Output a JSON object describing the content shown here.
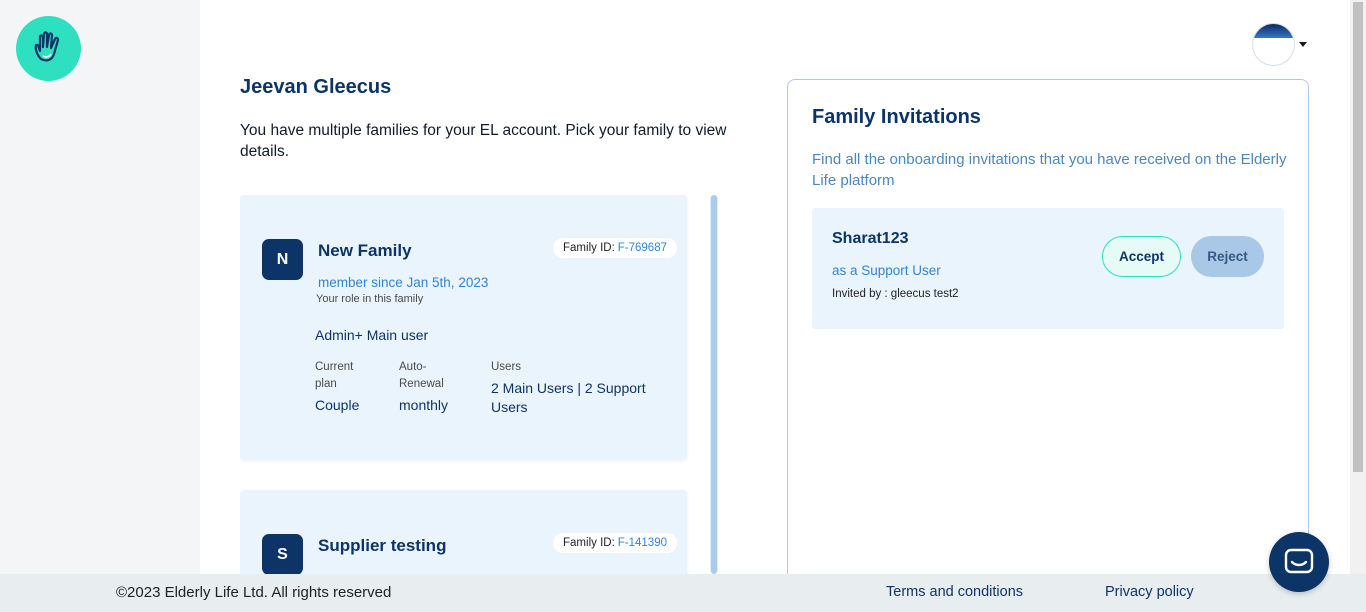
{
  "header": {
    "user_name": "Jeevan Gleecus"
  },
  "intro_text": "You have multiple families for your EL account. Pick your family to view details.",
  "families": [
    {
      "initial": "N",
      "name": "New Family",
      "family_id_label": "Family ID:",
      "family_id": "F-769687",
      "member_since": "member since Jan 5th, 2023",
      "role_label": "Your role in this family",
      "role_value": "Admin+ Main user",
      "plan_label": "Current plan",
      "plan_value": "Couple",
      "renewal_label": "Auto-Renewal",
      "renewal_value": "monthly",
      "users_label": "Users",
      "users_value": "2 Main Users | 2 Support Users"
    },
    {
      "initial": "S",
      "name": "Supplier testing",
      "family_id_label": "Family ID:",
      "family_id": "F-141390"
    }
  ],
  "invitations": {
    "title": "Family Invitations",
    "description": "Find all the onboarding invitations that you have received on the Elderly Life platform",
    "items": [
      {
        "name": "Sharat123",
        "role": "as a Support User",
        "invited_by": "Invited by : gleecus test2",
        "accept_label": "Accept",
        "reject_label": "Reject"
      }
    ]
  },
  "footer": {
    "copyright": "©2023 Elderly Life Ltd. All rights reserved",
    "terms": "Terms and conditions",
    "privacy": "Privacy policy"
  },
  "colors": {
    "navy": "#0d3466",
    "accent": "#2ee0c0",
    "link_blue": "#2d86d6",
    "card_bg": "#eaf4fd"
  },
  "icons": {
    "logo": "hand-logo-icon",
    "chat": "chat-icon",
    "caret": "caret-down-icon"
  }
}
